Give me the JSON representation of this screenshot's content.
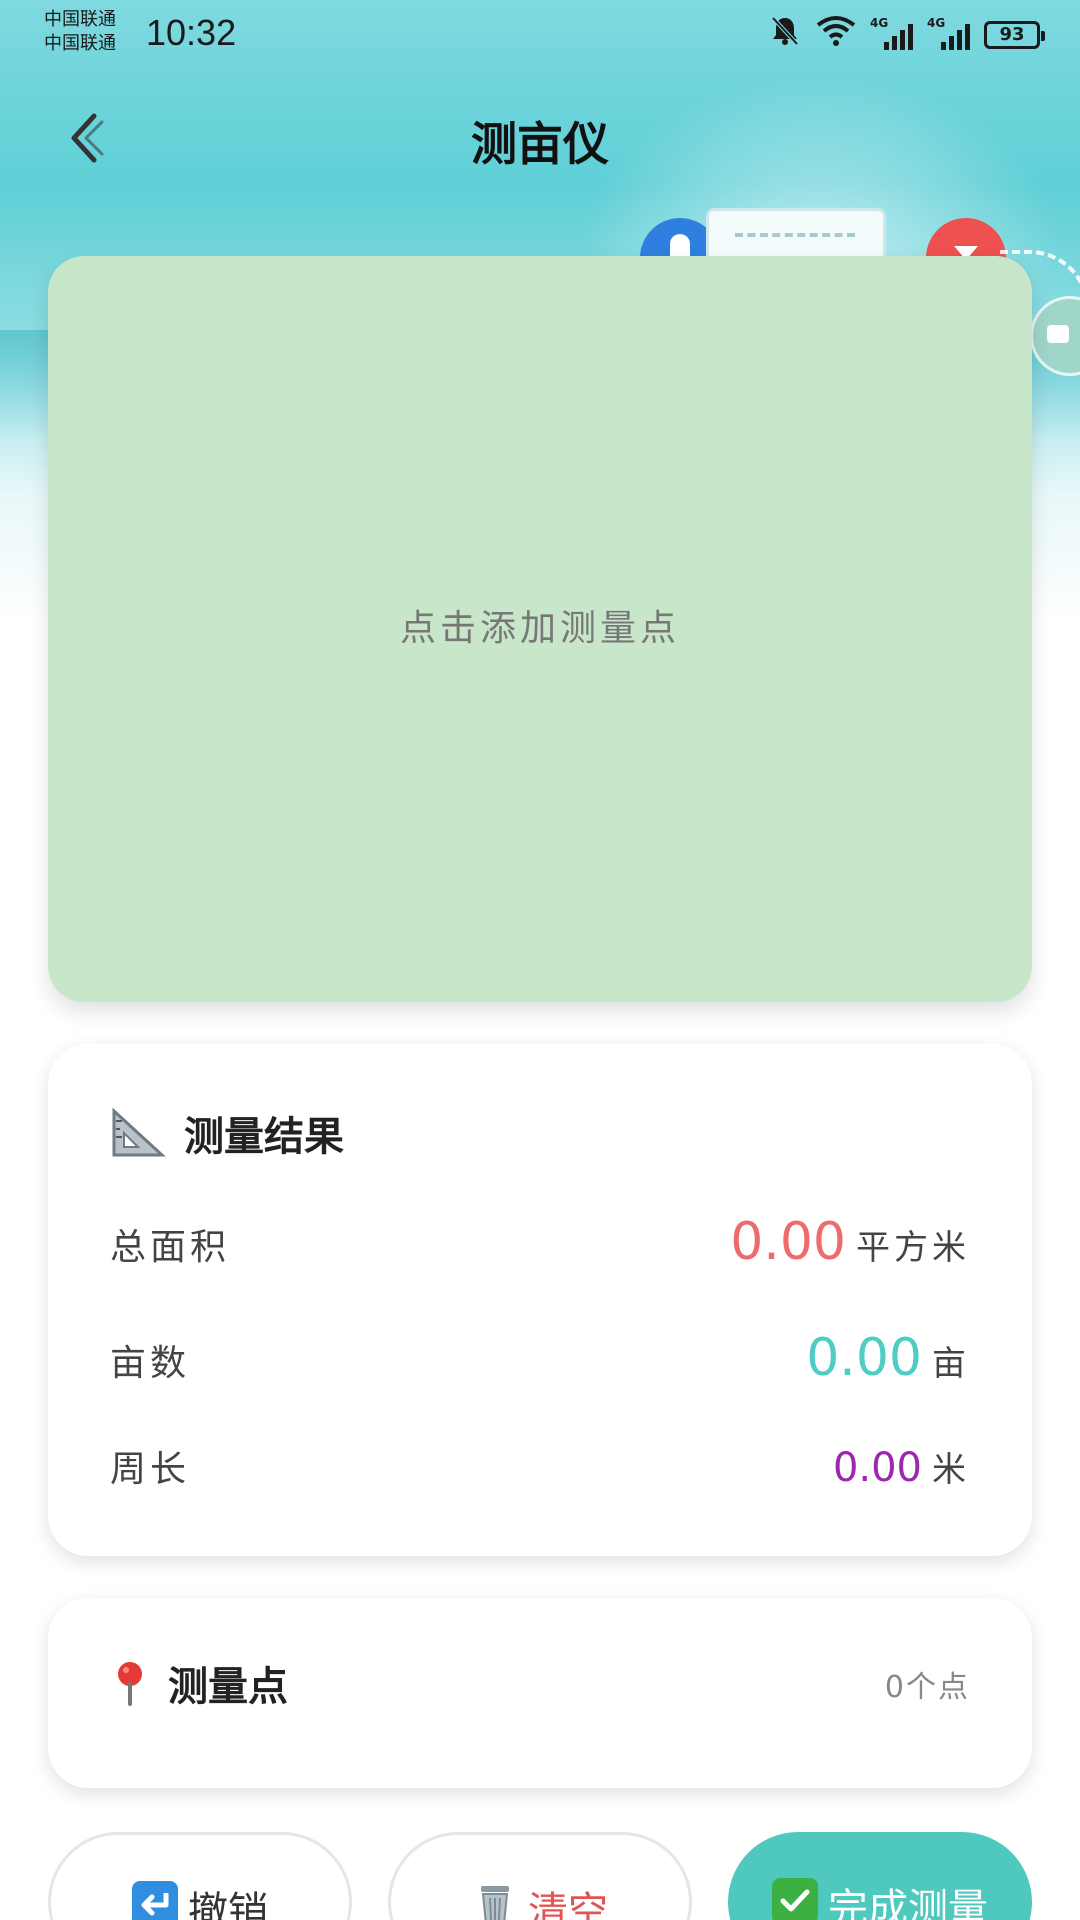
{
  "status_bar": {
    "carrier_1": "中国联通",
    "carrier_2": "中国联通",
    "time": "10:32",
    "signal_1_label": "4G",
    "signal_2_label": "4G",
    "battery": "93"
  },
  "header": {
    "title": "测亩仪"
  },
  "canvas": {
    "hint": "点击添加测量点",
    "background_color": "#c8e6c9"
  },
  "results": {
    "title": "测量结果",
    "title_icon": "triangle-ruler-icon",
    "area": {
      "label": "总面积",
      "value": "0.00",
      "unit": "平方米",
      "color": "#ef6b6b"
    },
    "mu": {
      "label": "亩数",
      "value": "0.00",
      "unit": "亩",
      "color": "#4ecdc4"
    },
    "perimeter": {
      "label": "周长",
      "value": "0.00",
      "unit": "米",
      "color": "#9c27b0"
    }
  },
  "points": {
    "title": "测量点",
    "title_icon": "pin-icon",
    "count": "0个点"
  },
  "actions": {
    "undo": {
      "label": "撤销",
      "icon": "undo-arrow-icon"
    },
    "clear": {
      "label": "清空",
      "icon": "trash-icon"
    },
    "finish": {
      "label": "完成测量",
      "icon": "check-box-icon"
    }
  }
}
